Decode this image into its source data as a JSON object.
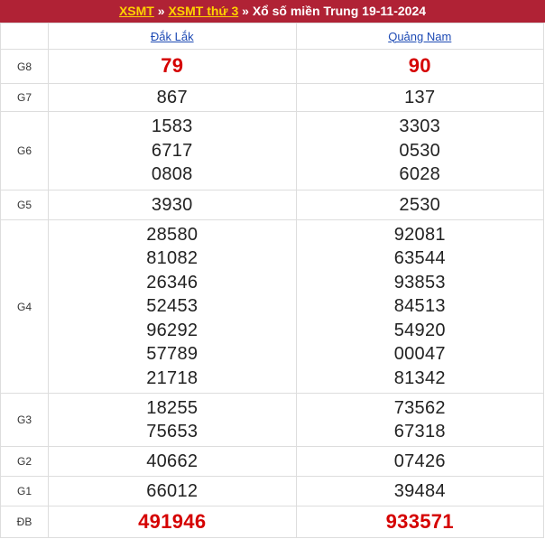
{
  "breadcrumb": {
    "part1": "XSMT",
    "sep1": "»",
    "part2": "XSMT thứ 3",
    "sep2": "»",
    "title": "Xổ số miền Trung 19-11-2024"
  },
  "provinces": [
    "Đắk Lắk",
    "Quảng Nam"
  ],
  "prizes": [
    {
      "label": "G8",
      "cols": [
        [
          "79"
        ],
        [
          "90"
        ]
      ]
    },
    {
      "label": "G7",
      "cols": [
        [
          "867"
        ],
        [
          "137"
        ]
      ]
    },
    {
      "label": "G6",
      "cols": [
        [
          "1583",
          "6717",
          "0808"
        ],
        [
          "3303",
          "0530",
          "6028"
        ]
      ]
    },
    {
      "label": "G5",
      "cols": [
        [
          "3930"
        ],
        [
          "2530"
        ]
      ]
    },
    {
      "label": "G4",
      "cols": [
        [
          "28580",
          "81082",
          "26346",
          "52453",
          "96292",
          "57789",
          "21718"
        ],
        [
          "92081",
          "63544",
          "93853",
          "84513",
          "54920",
          "00047",
          "81342"
        ]
      ]
    },
    {
      "label": "G3",
      "cols": [
        [
          "18255",
          "75653"
        ],
        [
          "73562",
          "67318"
        ]
      ]
    },
    {
      "label": "G2",
      "cols": [
        [
          "40662"
        ],
        [
          "07426"
        ]
      ]
    },
    {
      "label": "G1",
      "cols": [
        [
          "66012"
        ],
        [
          "39484"
        ]
      ]
    },
    {
      "label": "ĐB",
      "cols": [
        [
          "491946"
        ],
        [
          "933571"
        ]
      ]
    }
  ],
  "colors": {
    "header_bg": "#b02235",
    "header_link": "#ffd200",
    "highlight": "#d50000",
    "province_link": "#1d4ab4"
  }
}
